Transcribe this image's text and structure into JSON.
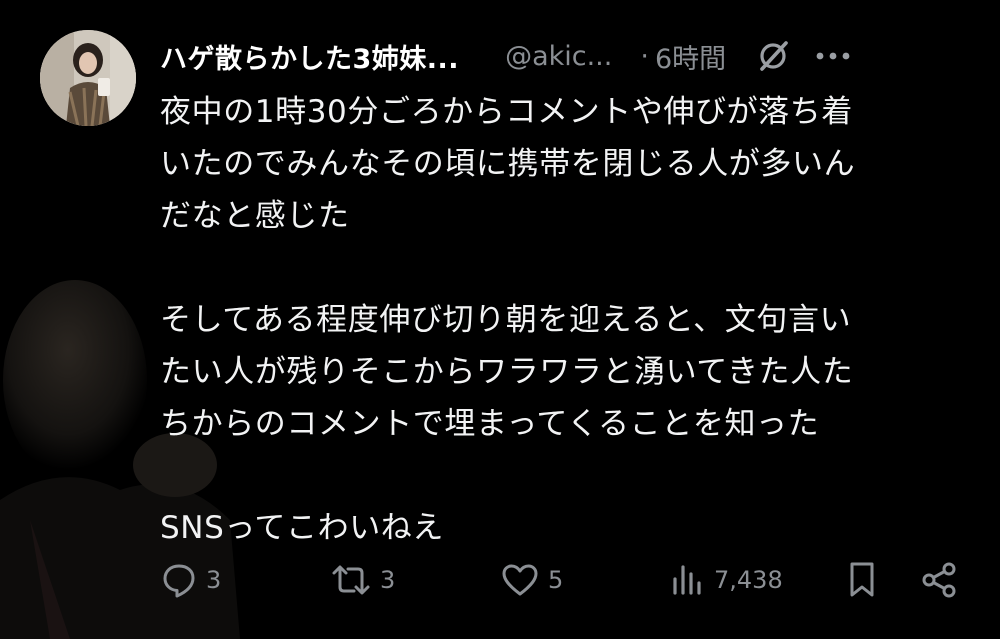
{
  "tweet": {
    "display_name": "ハゲ散らかした3姉妹...",
    "handle": "@akic...",
    "separator": "·",
    "time": "6時間",
    "grok_icon": "grok-slash-icon",
    "more_icon": "more-horizontal-icon",
    "body": {
      "line1": "夜中の1時30分ごろからコメントや伸びが落ち着",
      "line2": "いたのでみんなその頃に携帯を閉じる人が多いん",
      "line3": "だなと感じた",
      "line4": "そしてある程度伸び切り朝を迎えると、文句言い",
      "line5": "たい人が残りそこからワラワラと湧いてきた人た",
      "line6": "ちからのコメントで埋まってくることを知った",
      "line7": "SNSってこわいねえ"
    },
    "actions": {
      "reply_count": "3",
      "retweet_count": "3",
      "like_count": "5",
      "views_count": "7,438"
    }
  },
  "colors": {
    "background": "#000000",
    "text": "#e7e9ea",
    "secondary": "#8b8f94"
  }
}
